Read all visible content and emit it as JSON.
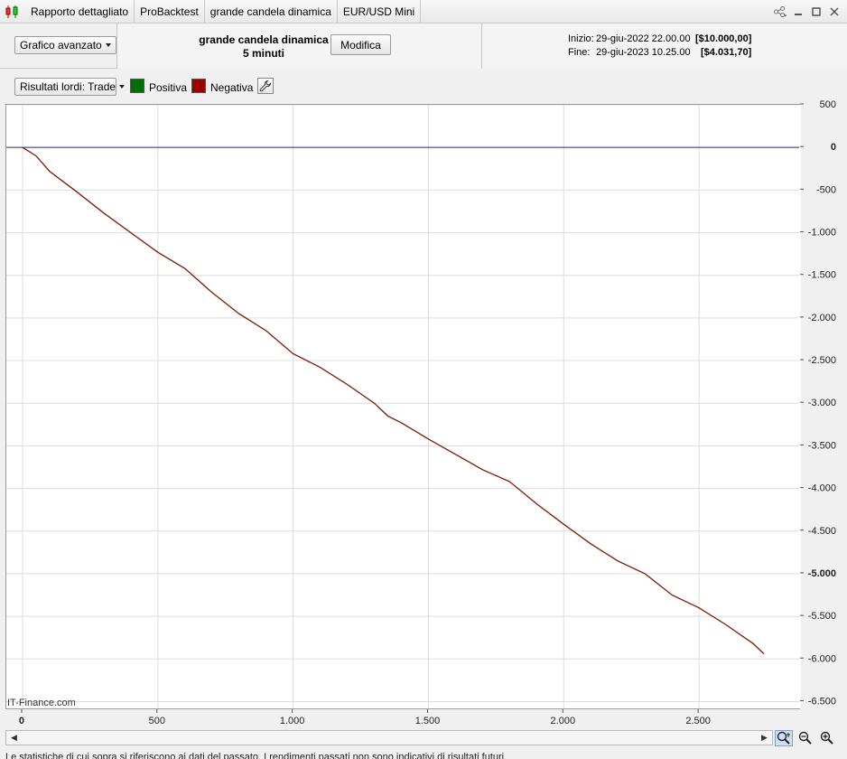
{
  "titlebar": {
    "icon": "candlestick-icon",
    "tabs": [
      "Rapporto dettagliato",
      "ProBacktest",
      "grande candela dinamica",
      "EUR/USD Mini"
    ]
  },
  "header": {
    "chart_mode_label": "Grafico avanzato",
    "strategy_name": "grande candela dinamica",
    "timeframe": "5 minuti",
    "edit_label": "Modifica",
    "start_label": "Inizio:",
    "start_date": "29-giu-2022 22.00.00",
    "start_capital": "[$10.000,00]",
    "end_label": "Fine:",
    "end_date": "29-giu-2023 10.25.00",
    "end_capital": "[$4.031,70]"
  },
  "toolbar": {
    "results_label": "Risultati lordi: Trade",
    "positive_label": "Positiva",
    "negative_label": "Negativa",
    "positive_color": "#007000",
    "negative_color": "#9b0000",
    "settings_icon": "wrench-icon"
  },
  "chart_data": {
    "type": "line",
    "series": [
      {
        "x": [
          0,
          50,
          100,
          200,
          300,
          400,
          500,
          600,
          700,
          800,
          900,
          1000,
          1100,
          1200,
          1300,
          1350,
          1400,
          1500,
          1600,
          1700,
          1800,
          1900,
          2000,
          2100,
          2200,
          2300,
          2400,
          2500,
          2600,
          2700,
          2740
        ],
        "y": [
          0,
          -100,
          -280,
          -520,
          -770,
          -1000,
          -1230,
          -1420,
          -1700,
          -1950,
          -2150,
          -2420,
          -2580,
          -2780,
          -3000,
          -3150,
          -3230,
          -3420,
          -3600,
          -3780,
          -3920,
          -4180,
          -4420,
          -4650,
          -4850,
          -5000,
          -5250,
          -5400,
          -5600,
          -5820,
          -5940
        ],
        "color": "#7a1a00"
      }
    ],
    "zero_line": 0,
    "xlim": [
      -60,
      2870
    ],
    "ylim": [
      -6580,
      500
    ],
    "xticks": [
      0,
      500,
      1000,
      1500,
      2000,
      2500
    ],
    "xtick_labels": [
      "0",
      "500",
      "1.000",
      "1.500",
      "2.000",
      "2.500"
    ],
    "yticks": [
      500,
      0,
      -500,
      -1000,
      -1500,
      -2000,
      -2500,
      -3000,
      -3500,
      -4000,
      -4500,
      -5000,
      -5500,
      -6000,
      -6500
    ],
    "ytick_labels": [
      "500",
      "0",
      "-500",
      "-1.000",
      "-1.500",
      "-2.000",
      "-2.500",
      "-3.000",
      "-3.500",
      "-4.000",
      "-4.500",
      "-5.000",
      "-5.500",
      "-6.000",
      "-6.500"
    ],
    "bold_yticks": [
      "0",
      "-5.000"
    ],
    "grid": true
  },
  "watermark": "IT-Finance.com",
  "footer_text": "Le statistiche di cui sopra si riferiscono ai dati del passato. I rendimenti passati non sono indicativi di risultati futuri."
}
